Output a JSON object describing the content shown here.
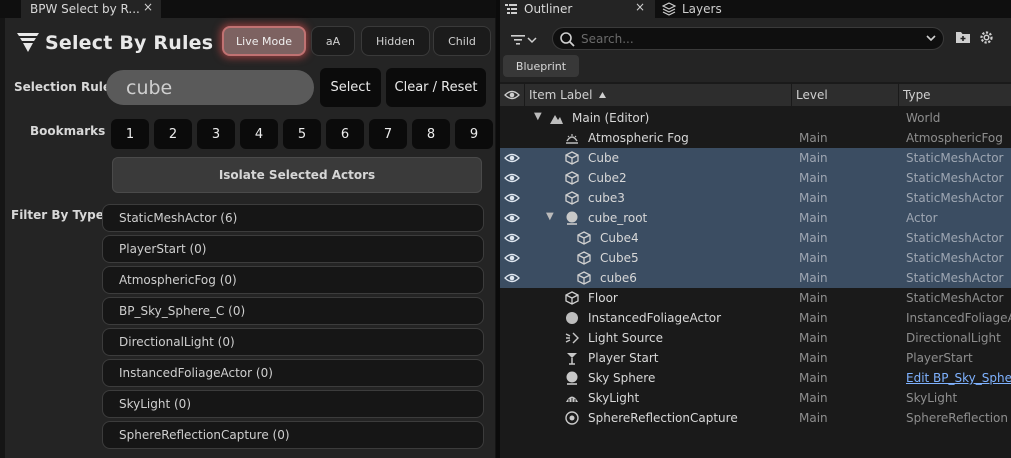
{
  "left_tab": {
    "title": "BPW Select by R...",
    "close": "×"
  },
  "plugin": {
    "title": "Select By Rules"
  },
  "toggles": {
    "live_mode": "Live Mode",
    "case": "aA",
    "hidden": "Hidden",
    "child": "Child"
  },
  "selection_rule": {
    "label": "Selection Rule",
    "value": "cube",
    "select_label": "Select",
    "clear_label": "Clear / Reset"
  },
  "bookmarks": {
    "label": "Bookmarks",
    "items": [
      "1",
      "2",
      "3",
      "4",
      "5",
      "6",
      "7",
      "8",
      "9"
    ]
  },
  "isolate_label": "Isolate Selected Actors",
  "filter_types": {
    "label": "Filter By Types",
    "items": [
      "StaticMeshActor  (6)",
      "PlayerStart  (0)",
      "AtmosphericFog  (0)",
      "BP_Sky_Sphere_C  (0)",
      "DirectionalLight  (0)",
      "InstancedFoliageActor  (0)",
      "SkyLight  (0)",
      "SphereReflectionCapture  (0)"
    ]
  },
  "outliner": {
    "tab_title": "Outliner",
    "close": "×",
    "layers_tab": "Layers",
    "search_placeholder": "Search...",
    "blueprint_filter": "Blueprint",
    "columns": {
      "label": "Item Label",
      "level": "Level",
      "type": "Type"
    },
    "rows": [
      {
        "label": "Main (Editor)",
        "level": "",
        "type": "World",
        "icon": "world-icon",
        "selected": false,
        "eye": false,
        "indent": 0,
        "expander": "down"
      },
      {
        "label": "Atmospheric Fog",
        "level": "Main",
        "type": "AtmosphericFog",
        "icon": "fog-icon",
        "selected": false,
        "eye": false,
        "indent": 1,
        "expander": ""
      },
      {
        "label": "Cube",
        "level": "Main",
        "type": "StaticMeshActor",
        "icon": "cube-icon",
        "selected": true,
        "eye": true,
        "indent": 1,
        "expander": ""
      },
      {
        "label": "Cube2",
        "level": "Main",
        "type": "StaticMeshActor",
        "icon": "cube-icon",
        "selected": true,
        "eye": true,
        "indent": 1,
        "expander": ""
      },
      {
        "label": "cube3",
        "level": "Main",
        "type": "StaticMeshActor",
        "icon": "cube-icon",
        "selected": true,
        "eye": true,
        "indent": 1,
        "expander": ""
      },
      {
        "label": "cube_root",
        "level": "Main",
        "type": "Actor",
        "icon": "actor-icon",
        "selected": true,
        "eye": true,
        "indent": 1,
        "expander": "down"
      },
      {
        "label": "Cube4",
        "level": "Main",
        "type": "StaticMeshActor",
        "icon": "cube-icon",
        "selected": true,
        "eye": true,
        "indent": 2,
        "expander": ""
      },
      {
        "label": "Cube5",
        "level": "Main",
        "type": "StaticMeshActor",
        "icon": "cube-icon",
        "selected": true,
        "eye": true,
        "indent": 2,
        "expander": ""
      },
      {
        "label": "cube6",
        "level": "Main",
        "type": "StaticMeshActor",
        "icon": "cube-icon",
        "selected": true,
        "eye": true,
        "indent": 2,
        "expander": ""
      },
      {
        "label": "Floor",
        "level": "Main",
        "type": "StaticMeshActor",
        "icon": "cube-icon",
        "selected": false,
        "eye": false,
        "indent": 1,
        "expander": ""
      },
      {
        "label": "InstancedFoliageActor",
        "level": "Main",
        "type": "InstancedFoliageA",
        "icon": "foliage-icon",
        "selected": false,
        "eye": false,
        "indent": 1,
        "expander": ""
      },
      {
        "label": "Light Source",
        "level": "Main",
        "type": "DirectionalLight",
        "icon": "light-icon",
        "selected": false,
        "eye": false,
        "indent": 1,
        "expander": ""
      },
      {
        "label": "Player Start",
        "level": "Main",
        "type": "PlayerStart",
        "icon": "player-start-icon",
        "selected": false,
        "eye": false,
        "indent": 1,
        "expander": ""
      },
      {
        "label": "Sky Sphere",
        "level": "Main",
        "type": "Edit BP_Sky_Sphe",
        "icon": "actor-icon",
        "selected": false,
        "eye": false,
        "indent": 1,
        "expander": "",
        "type_is_link": true
      },
      {
        "label": "SkyLight",
        "level": "Main",
        "type": "SkyLight",
        "icon": "skylight-icon",
        "selected": false,
        "eye": false,
        "indent": 1,
        "expander": ""
      },
      {
        "label": "SphereReflectionCapture",
        "level": "Main",
        "type": "SphereReflection",
        "icon": "reflection-icon",
        "selected": false,
        "eye": false,
        "indent": 1,
        "expander": ""
      }
    ]
  },
  "colors": {
    "selection": "#3b4d62",
    "live_mode_glow": "#c07272",
    "link": "#7fb2ff"
  }
}
